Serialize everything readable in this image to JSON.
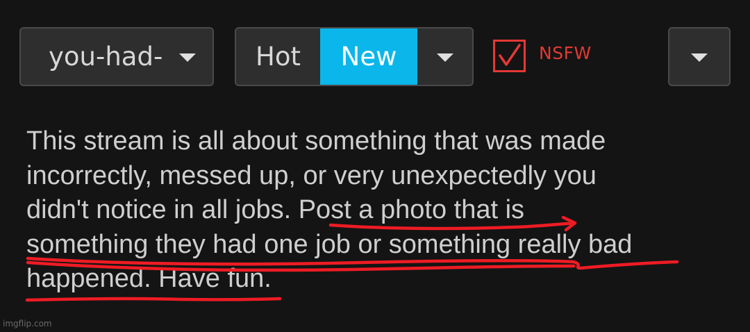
{
  "toolbar": {
    "stream_select": {
      "label": "you-had-",
      "icon": "chevron-down-icon"
    },
    "sort": {
      "options": [
        "Hot",
        "New"
      ],
      "selected": "New",
      "icon": "chevron-down-icon"
    },
    "nsfw": {
      "label": "NSFW",
      "checked": true
    },
    "menu": {
      "icon": "chevron-down-icon"
    }
  },
  "description": {
    "lines": [
      "This stream is all about something that was made",
      "incorrectly, messed up, or very unexpectedly you",
      "didn't notice in all jobs. Post a photo that is",
      "something they had one job or something really bad",
      "happened. Have fun."
    ]
  },
  "watermark": "imgflip.com",
  "colors": {
    "background": "#141414",
    "accent": "#0bb6ea",
    "nsfw": "#e53935",
    "annotation": "#ee1c24"
  }
}
